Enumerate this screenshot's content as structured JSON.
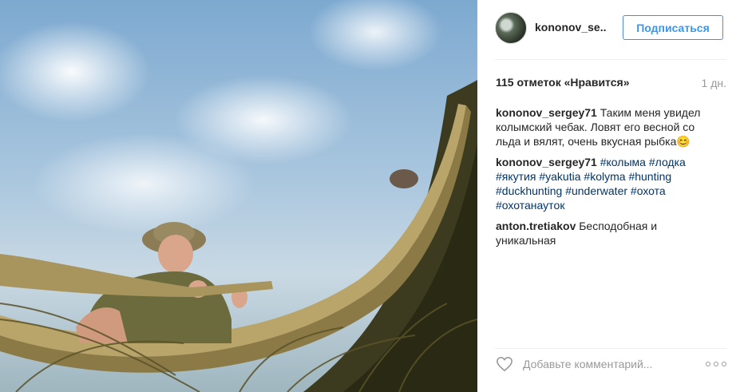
{
  "post": {
    "username": "kononov_se..",
    "follow_label": "Подписаться",
    "likes": "115 отметок «Нравится»",
    "time": "1 дн."
  },
  "comments": [
    {
      "author": "kononov_sergey71",
      "text": " Таким меня увидел колымский чебак. Ловят его весной со льда и вялят, очень вкусная рыбка😊"
    },
    {
      "author": "kononov_sergey71",
      "tags": [
        "#колыма",
        "#лодка",
        "#якутия",
        "#yakutia",
        "#kolyma",
        "#hunting",
        "#duckhunting",
        "#underwater",
        "#охота",
        "#охотанаутoк"
      ]
    },
    {
      "author": "anton.tretiakov",
      "text": " Бесподобная и уникальная"
    }
  ],
  "footer": {
    "comment_placeholder": "Добавьте комментарий...",
    "heart_icon": "heart-outline-icon",
    "more_icon": "more-options-icon"
  },
  "colors": {
    "follow_border": "#4a8dd8",
    "follow_text": "#3897f0",
    "hashtag": "#003569",
    "muted": "#999999"
  }
}
